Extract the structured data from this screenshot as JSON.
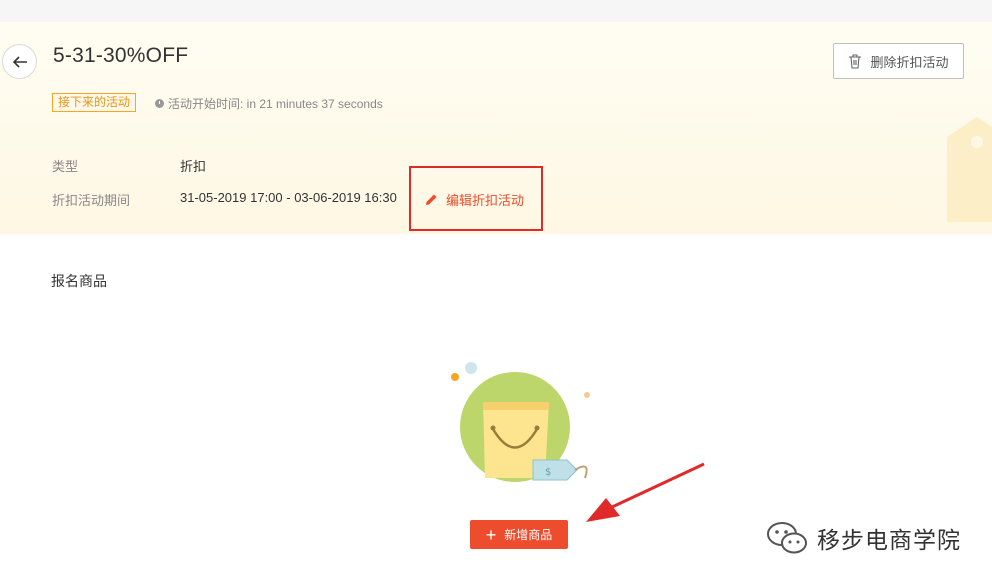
{
  "header": {
    "title": "5-31-30%OFF",
    "status_badge": "接下来的活动",
    "start_info": "活动开始时间: in 21 minutes 37 seconds",
    "delete_button": "删除折扣活动"
  },
  "details": {
    "type_label": "类型",
    "type_value": "折扣",
    "period_label": "折扣活动期间",
    "period_value": "31-05-2019 17:00 - 03-06-2019 16:30",
    "edit_link": "编辑折扣活动"
  },
  "products": {
    "section_title": "报名商品",
    "add_button": "新增商品"
  },
  "watermark": {
    "text": "移步电商学院"
  },
  "colors": {
    "accent": "#ee4d2d",
    "badge": "#f5a623",
    "annotation": "#e02a2a",
    "header_bg": "#fef7e3"
  },
  "icons": [
    "back-arrow-icon",
    "clock-icon",
    "trash-icon",
    "pencil-icon",
    "plus-icon",
    "shopping-bag-icon",
    "wechat-icon"
  ]
}
